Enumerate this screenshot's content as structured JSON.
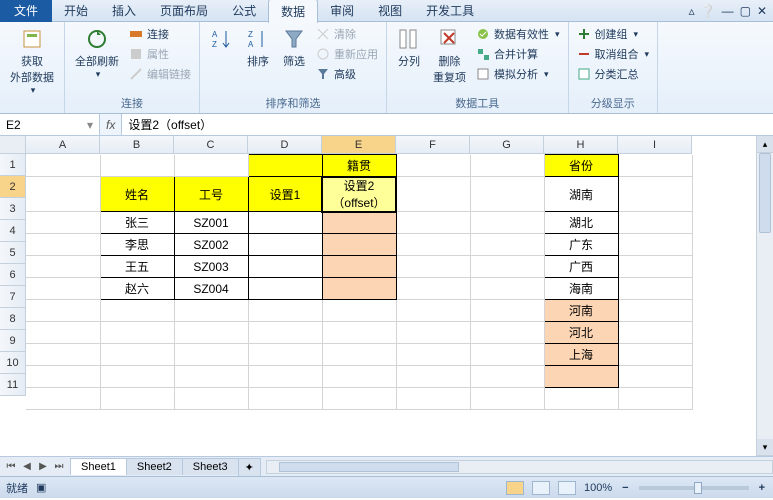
{
  "tabs": {
    "file": "文件",
    "home": "开始",
    "insert": "插入",
    "layout": "页面布局",
    "formula": "公式",
    "data": "数据",
    "review": "审阅",
    "view": "视图",
    "dev": "开发工具"
  },
  "ribbon": {
    "getData": "获取\n外部数据",
    "refreshAll": "全部刷新",
    "connections": "连接",
    "conn": "连接",
    "prop": "属性",
    "editLinks": "编辑链接",
    "sort": "排序",
    "filter": "筛选",
    "sortFilter": "排序和筛选",
    "clear": "清除",
    "reapply": "重新应用",
    "advanced": "高级",
    "textToCol": "分列",
    "removeDup": "删除\n重复项",
    "dataTools": "数据工具",
    "validation": "数据有效性",
    "consolidate": "合并计算",
    "whatif": "模拟分析",
    "group": "创建组",
    "ungroup": "取消组合",
    "subtotal": "分类汇总",
    "outline": "分级显示"
  },
  "nameBox": "E2",
  "formula": "设置2（offset）",
  "cols": [
    "A",
    "B",
    "C",
    "D",
    "E",
    "F",
    "G",
    "H",
    "I"
  ],
  "rows": [
    "1",
    "2",
    "3",
    "4",
    "5",
    "6",
    "7",
    "8",
    "9",
    "10",
    "11"
  ],
  "cells": {
    "E1": "籍贯",
    "B2": "姓名",
    "C2": "工号",
    "D2": "设置1",
    "E2": "设置2（offset）",
    "H1": "省份",
    "B3": "张三",
    "C3": "SZ001",
    "H2": "湖南",
    "B4": "李思",
    "C4": "SZ002",
    "H3": "湖北",
    "B5": "王五",
    "C5": "SZ003",
    "H4": "广东",
    "B6": "赵六",
    "C6": "SZ004",
    "H5": "广西",
    "H6": "海南",
    "H7": "河南",
    "H8": "河北",
    "H9": "上海"
  },
  "sheets": [
    "Sheet1",
    "Sheet2",
    "Sheet3"
  ],
  "status": "就绪",
  "zoom": "100%"
}
